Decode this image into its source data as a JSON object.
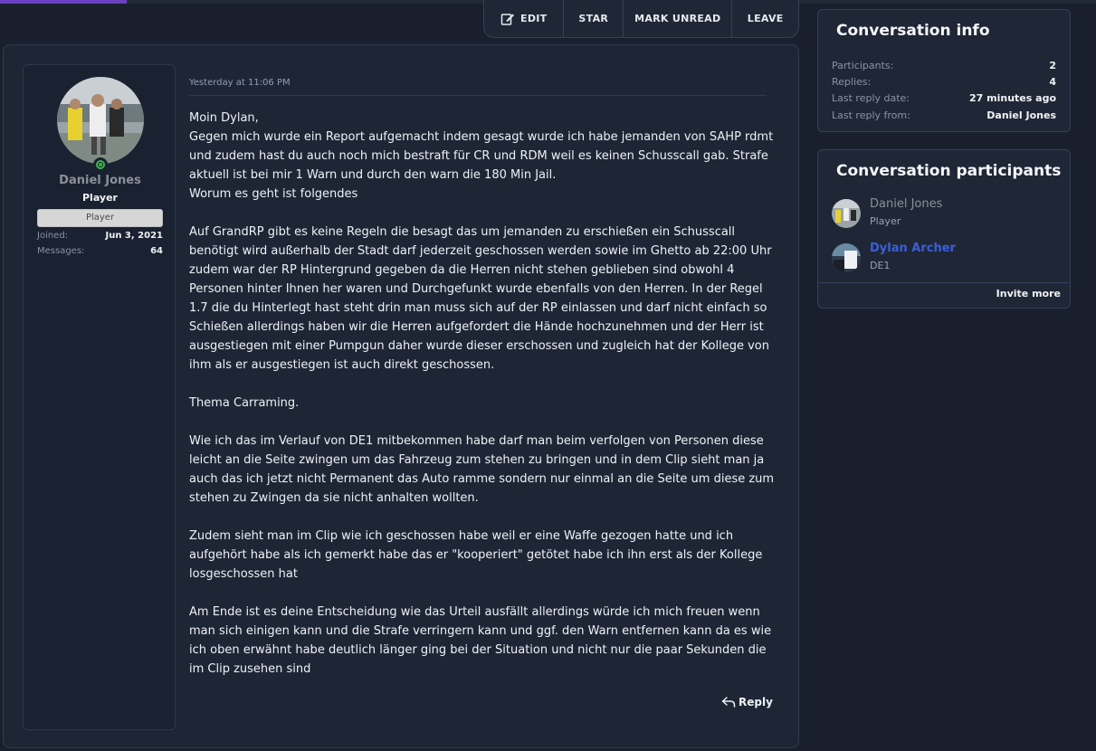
{
  "actions": {
    "edit": "EDIT",
    "star": "STAR",
    "mark_unread": "MARK UNREAD",
    "leave": "LEAVE"
  },
  "author": {
    "name": "Daniel Jones",
    "title": "Player",
    "banner": "Player",
    "stats": [
      {
        "label": "Joined:",
        "value": "Jun 3, 2021"
      },
      {
        "label": "Messages:",
        "value": "64"
      }
    ]
  },
  "message": {
    "date": "Yesterday at 11:06 PM",
    "paragraphs": [
      "Moin Dylan,\nGegen mich wurde ein Report aufgemacht indem gesagt wurde ich habe jemanden von SAHP rdmt und zudem hast du auch noch mich bestraft für CR und RDM weil es keinen Schusscall gab. Strafe aktuell ist bei mir 1 Warn und durch den warn die 180 Min Jail.\nWorum es geht ist folgendes",
      "Auf GrandRP gibt es keine Regeln die besagt das um jemanden zu erschießen ein Schusscall benötigt wird außerhalb der Stadt darf jederzeit geschossen werden sowie im Ghetto ab 22:00 Uhr zudem war der RP Hintergrund gegeben da die Herren nicht stehen geblieben sind obwohl 4 Personen hinter Ihnen her waren und Durchgefunkt wurde ebenfalls von den Herren. In der Regel 1.7 die du Hinterlegt hast steht drin man muss sich auf der RP einlassen und darf nicht einfach so Schießen allerdings haben wir die Herren aufgefordert die Hände hochzunehmen und der Herr ist ausgestiegen mit einer Pumpgun daher wurde dieser erschossen und zugleich hat der Kollege von ihm als er ausgestiegen ist auch direkt geschossen.",
      "Thema Carraming.",
      "Wie ich das im Verlauf von DE1 mitbekommen habe darf man beim verfolgen von Personen diese leicht an die Seite zwingen um das Fahrzeug zum stehen zu bringen und in dem Clip sieht man ja auch das ich jetzt nicht Permanent das Auto ramme sondern nur einmal an die Seite um diese zum stehen zu Zwingen da sie nicht anhalten wollten.",
      "Zudem sieht man im Clip wie ich geschossen habe weil er eine Waffe gezogen hatte und ich aufgehört habe als ich gemerkt habe das er \"kooperiert\" getötet habe ich ihn erst als der Kollege losgeschossen hat",
      "Am Ende ist es deine Entscheidung wie das Urteil ausfällt allerdings würde ich mich freuen wenn man sich einigen kann und die Strafe verringern kann und ggf. den Warn entfernen kann da es wie ich oben erwähnt habe deutlich länger ging bei der Situation und nicht nur die paar Sekunden die im Clip zusehen sind"
    ],
    "reply_label": "Reply"
  },
  "conversation_info": {
    "title": "Conversation info",
    "rows": [
      {
        "label": "Participants:",
        "value": "2"
      },
      {
        "label": "Replies:",
        "value": "4"
      },
      {
        "label": "Last reply date:",
        "value": "27 minutes ago"
      },
      {
        "label": "Last reply from:",
        "value": "Daniel Jones"
      }
    ]
  },
  "participants": {
    "title": "Conversation participants",
    "list": [
      {
        "name": "Daniel Jones",
        "role": "Player"
      },
      {
        "name": "Dylan Archer",
        "role": "DE1"
      }
    ],
    "invite_label": "Invite more"
  },
  "colors": {
    "page_bg": "#191f2c",
    "panel_bg": "#1e2636",
    "accent": "#6a3fc0",
    "online": "#3bb54a",
    "link_blue": "#3b5fd9"
  }
}
